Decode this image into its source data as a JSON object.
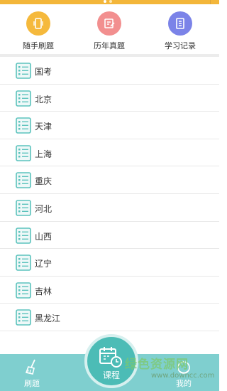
{
  "quick_actions": [
    {
      "label": "随手刷题",
      "icon": "phone-icon",
      "color": "#f5b93c"
    },
    {
      "label": "历年真题",
      "icon": "exam-paper-icon",
      "color": "#f28f8f"
    },
    {
      "label": "学习记录",
      "icon": "record-icon",
      "color": "#7b83e8"
    }
  ],
  "regions": [
    "国考",
    "北京",
    "天津",
    "上海",
    "重庆",
    "河北",
    "山西",
    "辽宁",
    "吉林",
    "黑龙江"
  ],
  "tabbar": {
    "left_label": "刷题",
    "center_label": "课程",
    "right_label": "我的",
    "accent": "#4cbcb6"
  },
  "watermark": {
    "main": "绿色资源网",
    "url": "www.downcc.com"
  }
}
